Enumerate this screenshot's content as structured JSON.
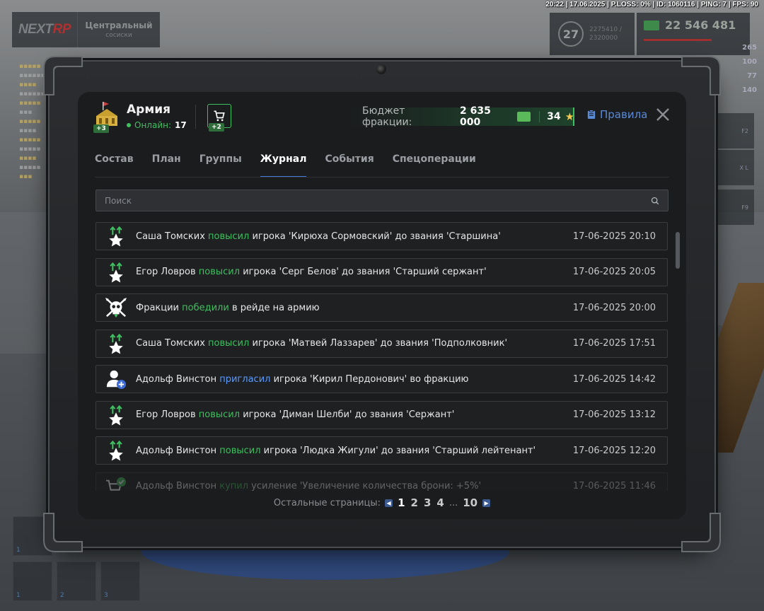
{
  "status_line": "20:22 | 17.06.2025 | P.LOSS: 0% | ID: 1060116 | PING: 7 | FPS: 90",
  "logo": {
    "brand_main": "NEXT",
    "brand_accent": "RP",
    "server_name": "Центральный",
    "server_sub": "сосиски"
  },
  "hud": {
    "level": "27",
    "xp_current": "2275410 /",
    "xp_total": "2320000",
    "money": "22 546 481",
    "stats": [
      "265",
      "100",
      "77",
      "140"
    ],
    "keys": [
      "F2",
      "X  L",
      "F9"
    ]
  },
  "slots": [
    "1",
    "2",
    "3",
    "1"
  ],
  "faction": {
    "name": "Армия",
    "online_label": "Онлайн:",
    "online_count": "17",
    "icon_badge": "+3",
    "shop_badge": "+2"
  },
  "budget": {
    "label": "Бюджет фракции:",
    "money": "2 635 000",
    "stars": "34"
  },
  "rules_label": "Правила",
  "tabs": [
    {
      "label": "Состав",
      "active": false
    },
    {
      "label": "План",
      "active": false
    },
    {
      "label": "Группы",
      "active": false
    },
    {
      "label": "Журнал",
      "active": true
    },
    {
      "label": "События",
      "active": false
    },
    {
      "label": "Спецоперации",
      "active": false
    }
  ],
  "search": {
    "placeholder": "Поиск"
  },
  "log": [
    {
      "icon": "rank-up-icon",
      "actor": "Саша Томских",
      "action": "повысил",
      "action_color": "green",
      "rest": " игрока 'Кирюха Сормовский' до звания 'Старшина'",
      "date": "17-06-2025 20:10"
    },
    {
      "icon": "rank-up-icon",
      "actor": "Егор Ловров",
      "action": "повысил",
      "action_color": "green",
      "rest": " игрока 'Серг Белов' до звания 'Старший сержант'",
      "date": "17-06-2025 20:05"
    },
    {
      "icon": "skull-icon",
      "actor": "Фракции",
      "action": "победили",
      "action_color": "green",
      "rest": " в рейде на армию",
      "date": "17-06-2025 20:00"
    },
    {
      "icon": "rank-up-icon",
      "actor": "Саша Томских",
      "action": "повысил",
      "action_color": "green",
      "rest": " игрока 'Матвей Лаззарев' до звания 'Подполковник'",
      "date": "17-06-2025 17:51"
    },
    {
      "icon": "user-add-icon",
      "actor": "Адольф Винстон",
      "action": "пригласил",
      "action_color": "blue",
      "rest": " игрока 'Кирил Пердонович' во фракцию",
      "date": "17-06-2025 14:42"
    },
    {
      "icon": "rank-up-icon",
      "actor": "Егор Ловров",
      "action": "повысил",
      "action_color": "green",
      "rest": " игрока 'Диман Шелби' до звания 'Сержант'",
      "date": "17-06-2025 13:12"
    },
    {
      "icon": "rank-up-icon",
      "actor": "Адольф Винстон",
      "action": "повысил",
      "action_color": "green",
      "rest": " игрока 'Людка Жигули' до звания 'Старший лейтенант'",
      "date": "17-06-2025 12:20"
    },
    {
      "icon": "cart-check-icon",
      "actor": "Адольф Винстон",
      "action": "купил",
      "action_color": "green",
      "rest": " усиление 'Увеличение количества брони: +5%'",
      "date": "17-06-2025 11:46"
    }
  ],
  "pager": {
    "label": "Остальные страницы:",
    "pages": [
      "1",
      "2",
      "3",
      "4"
    ],
    "ellipsis": "...",
    "last": "10",
    "current": "1"
  },
  "colors": {
    "accent_green": "#3fbf5f",
    "accent_blue": "#5a9aff",
    "rules_blue": "#5a8ad8",
    "star": "#f2c94c"
  }
}
